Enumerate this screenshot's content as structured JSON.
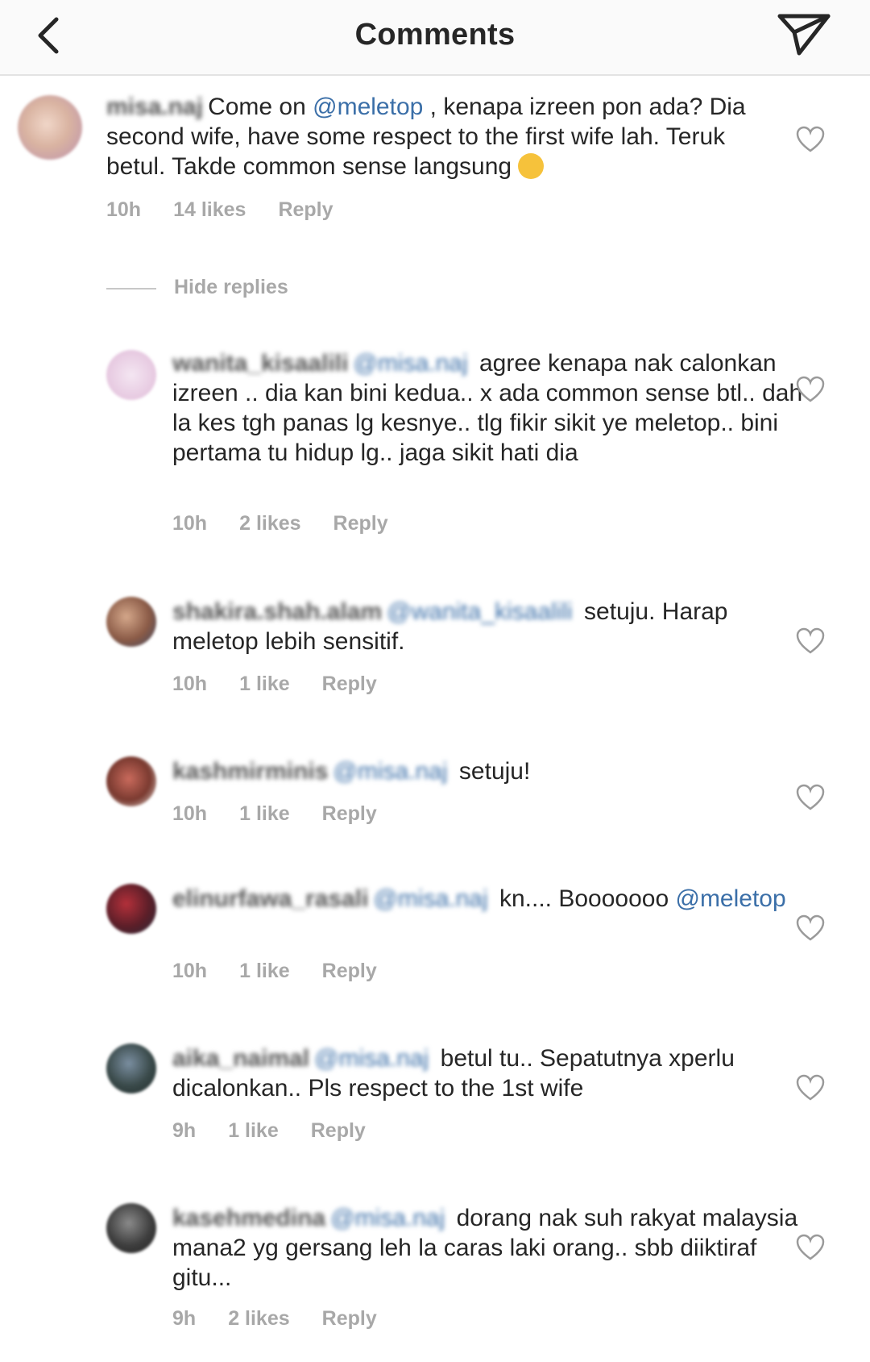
{
  "header": {
    "title": "Comments"
  },
  "hide_replies": "Hide replies",
  "comments": [
    {
      "username": "misa.naj",
      "before": "Come on ",
      "mention": "@meletop",
      "after": " , kenapa izreen pon ada? Dia second wife, have some respect to the first wife lah. Teruk betul. Takde common sense langsung",
      "time": "10h",
      "likes": "14 likes",
      "reply": "Reply"
    },
    {
      "username": "wanita_kisaalili",
      "mention": "@misa.naj",
      "after": " agree kenapa nak calonkan izreen .. dia kan bini kedua.. x ada common sense btl.. dah la kes tgh panas lg kesnye.. tlg fikir sikit ye meletop.. bini pertama tu hidup lg.. jaga sikit hati dia",
      "time": "10h",
      "likes": "2 likes",
      "reply": "Reply"
    },
    {
      "username": "shakira.shah.alam",
      "mention": "@wanita_kisaalili",
      "after": " setuju. Harap meletop lebih sensitif.",
      "time": "10h",
      "likes": "1 like",
      "reply": "Reply"
    },
    {
      "username": "kashmirminis",
      "mention": "@misa.naj",
      "after": " setuju!",
      "time": "10h",
      "likes": "1 like",
      "reply": "Reply"
    },
    {
      "username": "elinurfawa_rasali",
      "mention": "@misa.naj",
      "after": " kn.... Booooooo ",
      "mention2": "@meletop",
      "time": "10h",
      "likes": "1 like",
      "reply": "Reply"
    },
    {
      "username": "aika_naimal",
      "mention": "@misa.naj",
      "after": " betul tu.. Sepatutnya xperlu dicalonkan.. Pls respect to the 1st wife",
      "time": "9h",
      "likes": "1 like",
      "reply": "Reply"
    },
    {
      "username": "kasehmedina",
      "mention": "@misa.naj",
      "after": " dorang nak suh rakyat malaysia mana2 yg gersang leh la caras laki orang.. sbb diiktiraf gitu...",
      "time": "9h",
      "likes": "2 likes",
      "reply": "Reply"
    }
  ]
}
